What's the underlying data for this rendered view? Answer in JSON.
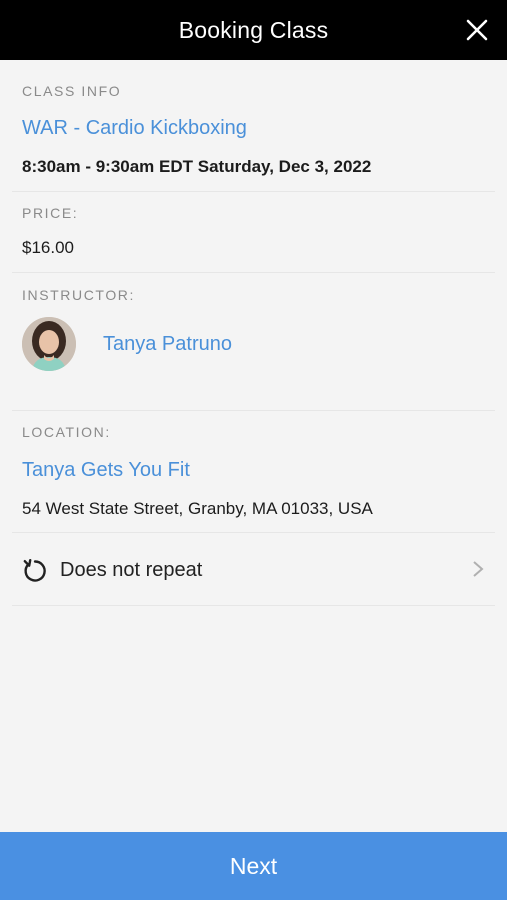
{
  "header": {
    "title": "Booking Class",
    "close_icon": "close-icon"
  },
  "class_info": {
    "label": "CLASS INFO",
    "name": "WAR - Cardio Kickboxing",
    "datetime": "8:30am - 9:30am EDT Saturday, Dec 3, 2022"
  },
  "price": {
    "label": "PRICE:",
    "value": "$16.00"
  },
  "instructor": {
    "label": "INSTRUCTOR:",
    "name": "Tanya Patruno"
  },
  "location": {
    "label": "LOCATION:",
    "name": "Tanya Gets You Fit",
    "address": "54 West State Street, Granby, MA 01033, USA"
  },
  "repeat": {
    "icon": "repeat-icon",
    "text": "Does not repeat",
    "chevron": "chevron-right-icon"
  },
  "footer": {
    "next_label": "Next"
  },
  "colors": {
    "header_bg": "#000000",
    "link": "#4a90d9",
    "button_bg": "#4a90e2",
    "page_bg": "#f4f4f4"
  }
}
